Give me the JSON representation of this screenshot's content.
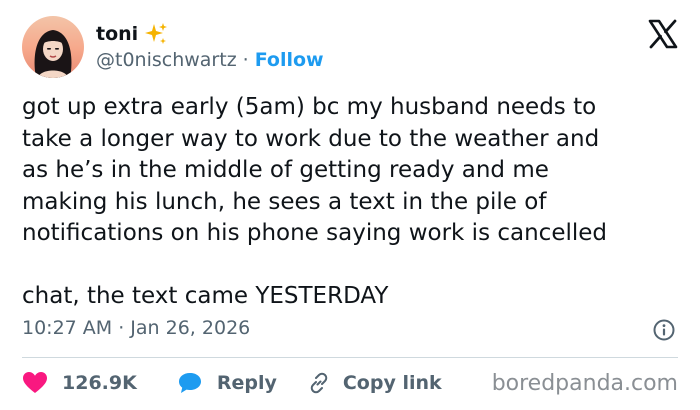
{
  "author": {
    "display_name": "toni",
    "handle": "@t0nischwartz",
    "separator": "·",
    "follow_label": "Follow",
    "name_emoji_icon": "sparkles-icon",
    "avatar_icon": "avatar-illustration"
  },
  "platform": {
    "logo_icon": "x-logo-icon"
  },
  "tweet": {
    "text": "got up extra early (5am) bc my husband needs to\ntake a longer way to work due to the weather and\nas he’s in the middle of getting ready and me\nmaking his lunch, he sees a text in the pile of\nnotifications on his phone saying work is cancelled\n\nchat, the text came YESTERDAY",
    "timestamp": "10:27 AM · Jan 26, 2026",
    "info_icon": "info-icon"
  },
  "actions": {
    "likes_count": "126.9K",
    "likes_icon": "heart-icon",
    "reply_label": "Reply",
    "reply_icon": "speech-bubble-icon",
    "copy_label": "Copy link",
    "copy_icon": "link-icon"
  },
  "watermark": "boredpanda.com",
  "colors": {
    "text": "#0f1419",
    "secondary": "#536471",
    "link": "#1d9bf0",
    "like": "#f91880",
    "divider": "#cfd9de"
  }
}
